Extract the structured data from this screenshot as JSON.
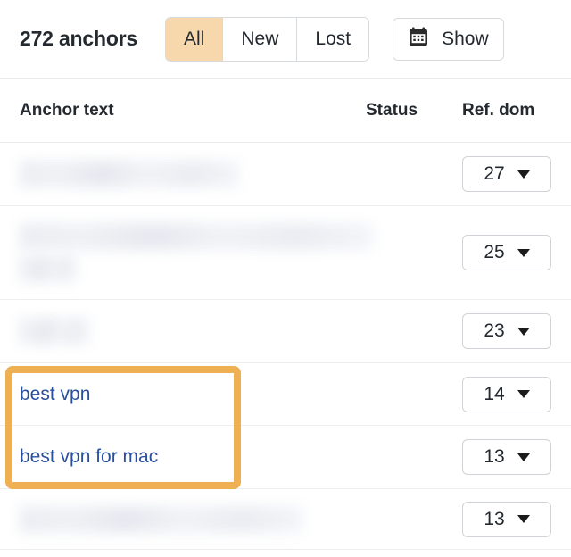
{
  "toolbar": {
    "anchors_count": "272 anchors",
    "filters": [
      {
        "label": "All",
        "active": true
      },
      {
        "label": "New",
        "active": false
      },
      {
        "label": "Lost",
        "active": false
      }
    ],
    "date_button": {
      "icon": "calendar-icon",
      "label": "Show"
    }
  },
  "table": {
    "columns": [
      {
        "key": "anchor_text",
        "label": "Anchor text"
      },
      {
        "key": "status",
        "label": "Status"
      },
      {
        "key": "ref_domains",
        "label": "Ref. dom"
      }
    ],
    "rows": [
      {
        "anchor_text": "",
        "redacted": true,
        "redacted_lines": [
          246
        ],
        "status": "",
        "ref_domains": "27"
      },
      {
        "anchor_text": "",
        "redacted": true,
        "redacted_lines": [
          396,
          64
        ],
        "status": "",
        "ref_domains": "25"
      },
      {
        "anchor_text": "",
        "redacted": true,
        "redacted_lines": [
          78
        ],
        "status": "",
        "ref_domains": "23"
      },
      {
        "anchor_text": "best vpn",
        "redacted": false,
        "status": "",
        "ref_domains": "14"
      },
      {
        "anchor_text": "best vpn for mac",
        "redacted": false,
        "status": "",
        "ref_domains": "13"
      },
      {
        "anchor_text": "",
        "redacted": true,
        "redacted_lines": [
          318
        ],
        "status": "",
        "ref_domains": "13"
      }
    ]
  },
  "highlight": {
    "color": "#efb054",
    "rows": [
      "best vpn",
      "best vpn for mac"
    ]
  },
  "colors": {
    "accent_highlight": "#efb054",
    "active_filter_bg": "#f7d8ad",
    "link": "#2a4f9e",
    "text": "#23292f",
    "border": "#e8eaed"
  }
}
